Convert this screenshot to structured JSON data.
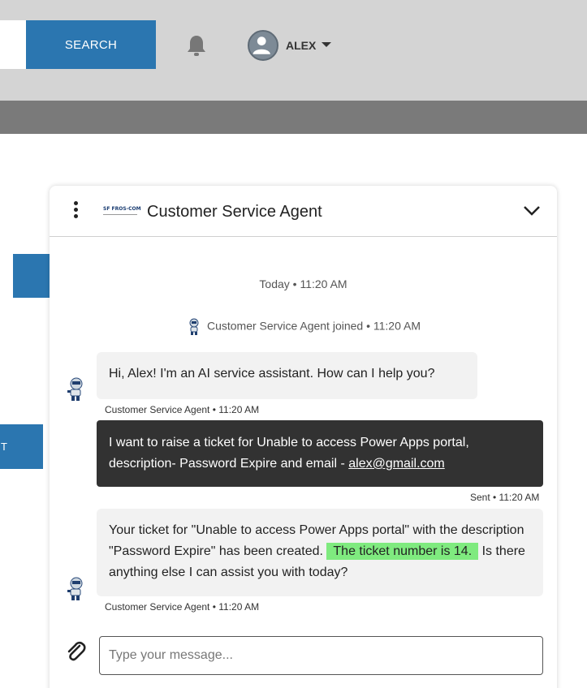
{
  "header": {
    "search_button": "SEARCH",
    "user_name": "ALEX",
    "icons": {
      "notifications": "bell-icon",
      "avatar": "user-avatar-icon",
      "menu": "caret-down-icon"
    }
  },
  "background": {
    "button_2_text": "T"
  },
  "chat": {
    "logo_text": "SF FROS-COM",
    "title": "Customer Service Agent",
    "day_stamp": "Today • 11:20 AM",
    "joined_text": "Customer Service Agent joined • 11:20 AM",
    "messages": [
      {
        "from": "agent",
        "text": "Hi, Alex! I'm an AI service assistant. How can I help you?",
        "meta": "Customer Service Agent • 11:20 AM"
      },
      {
        "from": "user",
        "text_before": "I want to raise a ticket for Unable to access Power Apps portal, description- Password Expire and email - ",
        "link": "alex@gmail.com",
        "meta": "Sent • 11:20 AM"
      },
      {
        "from": "agent",
        "text_before": "Your ticket for \"Unable to access Power Apps portal\" with the description \"Password Expire\" has been created. ",
        "highlight": "The ticket number is 14.",
        "text_after": " Is there anything else I can assist you with today?",
        "meta": "Customer Service Agent • 11:20 AM"
      }
    ],
    "input_placeholder": "Type your message...",
    "colors": {
      "accent": "#2b76b0",
      "highlight": "#7fea7f",
      "user_bubble": "#323232",
      "agent_bubble": "#f2f2f2"
    }
  }
}
